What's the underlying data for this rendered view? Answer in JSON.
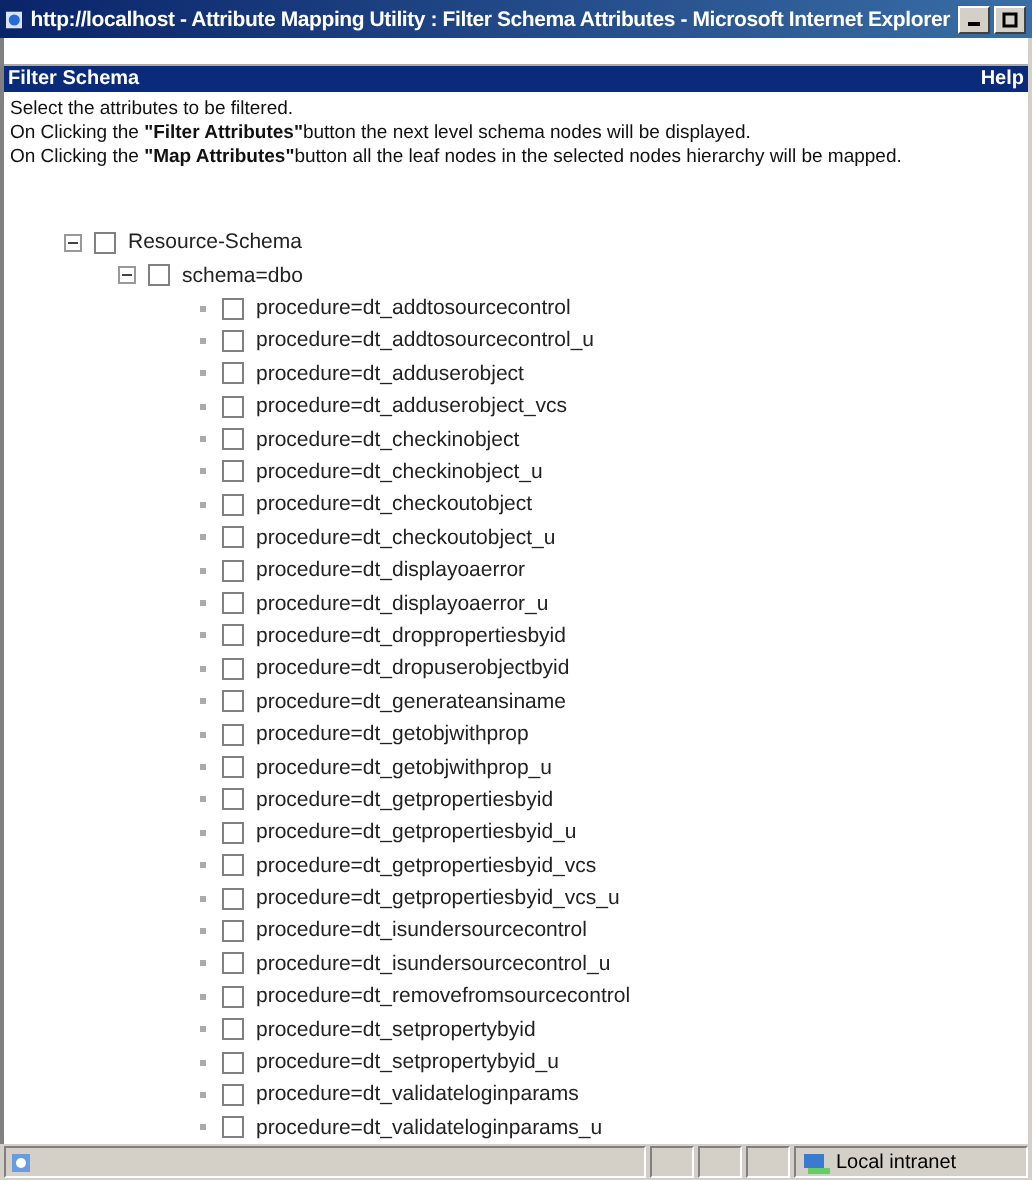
{
  "window": {
    "title": "http://localhost - Attribute Mapping Utility : Filter Schema Attributes - Microsoft Internet Explorer"
  },
  "header": {
    "title": "Filter Schema",
    "help": "Help"
  },
  "instructions": [
    "Select the attributes to be filtered.",
    "On Clicking the **\"Filter Attributes\"**button the next level schema nodes will be displayed.",
    "On Clicking the **\"Map Attributes\"**button all the leaf nodes in the selected nodes hierarchy will be mapped."
  ],
  "tree": [
    {
      "label": "Resource-Schema",
      "checked": false,
      "expanded": true,
      "children": [
        {
          "label": "schema=dbo",
          "checked": false,
          "expanded": true,
          "children": [
            {
              "label": "procedure=dt_addtosourcecontrol",
              "checked": false
            },
            {
              "label": "procedure=dt_addtosourcecontrol_u",
              "checked": false
            },
            {
              "label": "procedure=dt_adduserobject",
              "checked": false
            },
            {
              "label": "procedure=dt_adduserobject_vcs",
              "checked": false
            },
            {
              "label": "procedure=dt_checkinobject",
              "checked": false
            },
            {
              "label": "procedure=dt_checkinobject_u",
              "checked": false
            },
            {
              "label": "procedure=dt_checkoutobject",
              "checked": false
            },
            {
              "label": "procedure=dt_checkoutobject_u",
              "checked": false
            },
            {
              "label": "procedure=dt_displayoaerror",
              "checked": false
            },
            {
              "label": "procedure=dt_displayoaerror_u",
              "checked": false
            },
            {
              "label": "procedure=dt_droppropertiesbyid",
              "checked": false
            },
            {
              "label": "procedure=dt_dropuserobjectbyid",
              "checked": false
            },
            {
              "label": "procedure=dt_generateansiname",
              "checked": false
            },
            {
              "label": "procedure=dt_getobjwithprop",
              "checked": false
            },
            {
              "label": "procedure=dt_getobjwithprop_u",
              "checked": false
            },
            {
              "label": "procedure=dt_getpropertiesbyid",
              "checked": false
            },
            {
              "label": "procedure=dt_getpropertiesbyid_u",
              "checked": false
            },
            {
              "label": "procedure=dt_getpropertiesbyid_vcs",
              "checked": false
            },
            {
              "label": "procedure=dt_getpropertiesbyid_vcs_u",
              "checked": false
            },
            {
              "label": "procedure=dt_isundersourcecontrol",
              "checked": false
            },
            {
              "label": "procedure=dt_isundersourcecontrol_u",
              "checked": false
            },
            {
              "label": "procedure=dt_removefromsourcecontrol",
              "checked": false
            },
            {
              "label": "procedure=dt_setpropertybyid",
              "checked": false
            },
            {
              "label": "procedure=dt_setpropertybyid_u",
              "checked": false
            },
            {
              "label": "procedure=dt_validateloginparams",
              "checked": false
            },
            {
              "label": "procedure=dt_validateloginparams_u",
              "checked": false
            }
          ]
        }
      ]
    }
  ],
  "status_bar": {
    "zone": "Local intranet"
  }
}
